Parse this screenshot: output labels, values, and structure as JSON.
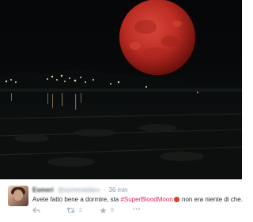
{
  "tweet": {
    "display_name": "Esmeri",
    "handle": "@esmeraldaxx",
    "time": "36 min",
    "text_before": "Avete fatto bene a dormire, sta ",
    "hashtag": "#SuperBloodMoon",
    "text_after": " non era niente di che.",
    "retweet_count": "2",
    "like_count": "8",
    "more_label": "•••"
  },
  "icons": {
    "reply": "reply-icon",
    "retweet": "retweet-icon",
    "like": "star-icon",
    "more": "more-icon",
    "moon_emoji": "full-moon-emoji"
  },
  "colors": {
    "moon": "#c5322a",
    "hashtag": "#e0245e",
    "meta_text": "#8899a6",
    "action_icons": "#aab8c2"
  }
}
